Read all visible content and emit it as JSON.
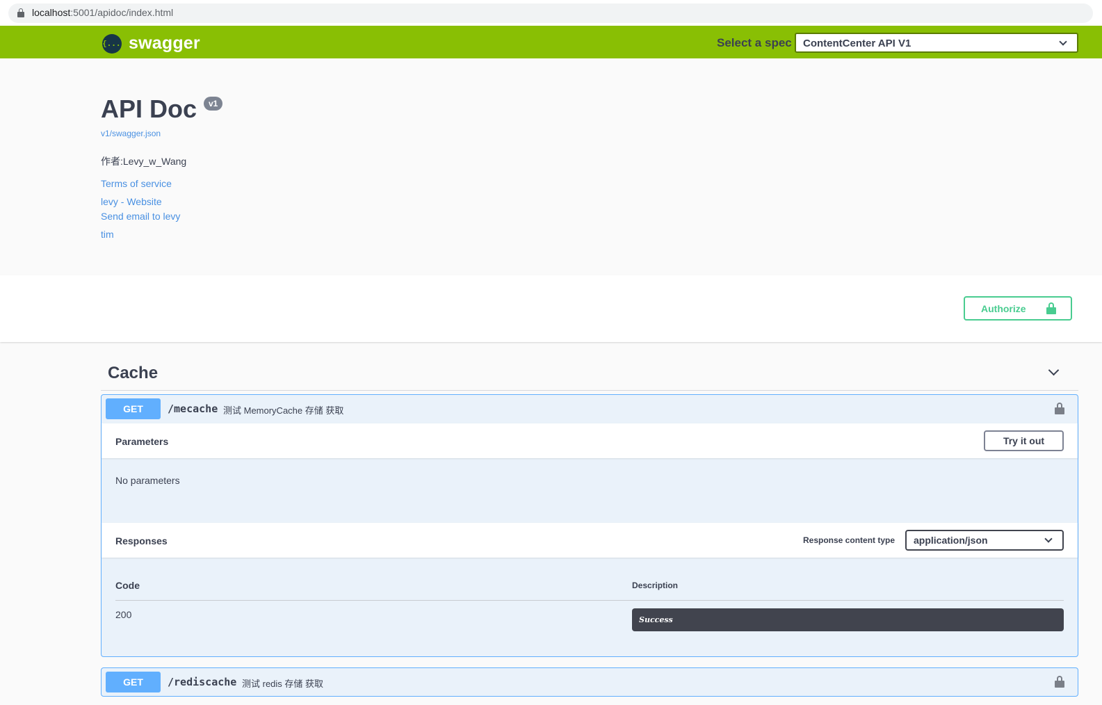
{
  "browser": {
    "url_host": "localhost",
    "url_rest": ":5001/apidoc/index.html"
  },
  "topbar": {
    "logo_mark": "{...}",
    "logo_text": "swagger",
    "spec_label": "Select a spec",
    "spec_value": "ContentCenter API V1"
  },
  "info": {
    "title": "API Doc",
    "version": "v1",
    "spec_url": "v1/swagger.json",
    "description": "作者:Levy_w_Wang",
    "links": {
      "terms": "Terms of service",
      "website": "levy - Website",
      "email": "Send email to levy",
      "license": "tim"
    }
  },
  "scheme": {
    "authorize_label": "Authorize"
  },
  "tag": {
    "name": "Cache"
  },
  "operations": [
    {
      "method": "GET",
      "path": "/mecache",
      "summary": "测试 MemoryCache 存储 获取",
      "parameters_title": "Parameters",
      "try_it_out": "Try it out",
      "no_parameters": "No parameters",
      "responses_title": "Responses",
      "response_content_type_label": "Response content type",
      "response_content_type": "application/json",
      "table_header_code": "Code",
      "table_header_description": "Description",
      "responses": [
        {
          "code": "200",
          "description": "Success"
        }
      ]
    },
    {
      "method": "GET",
      "path": "/rediscache",
      "summary": "测试 redis 存储 获取"
    }
  ],
  "colors": {
    "topbar": "#89bf04",
    "get_method": "#61affe",
    "authorize": "#49cc90",
    "link": "#4990e2",
    "text": "#3b4151"
  }
}
